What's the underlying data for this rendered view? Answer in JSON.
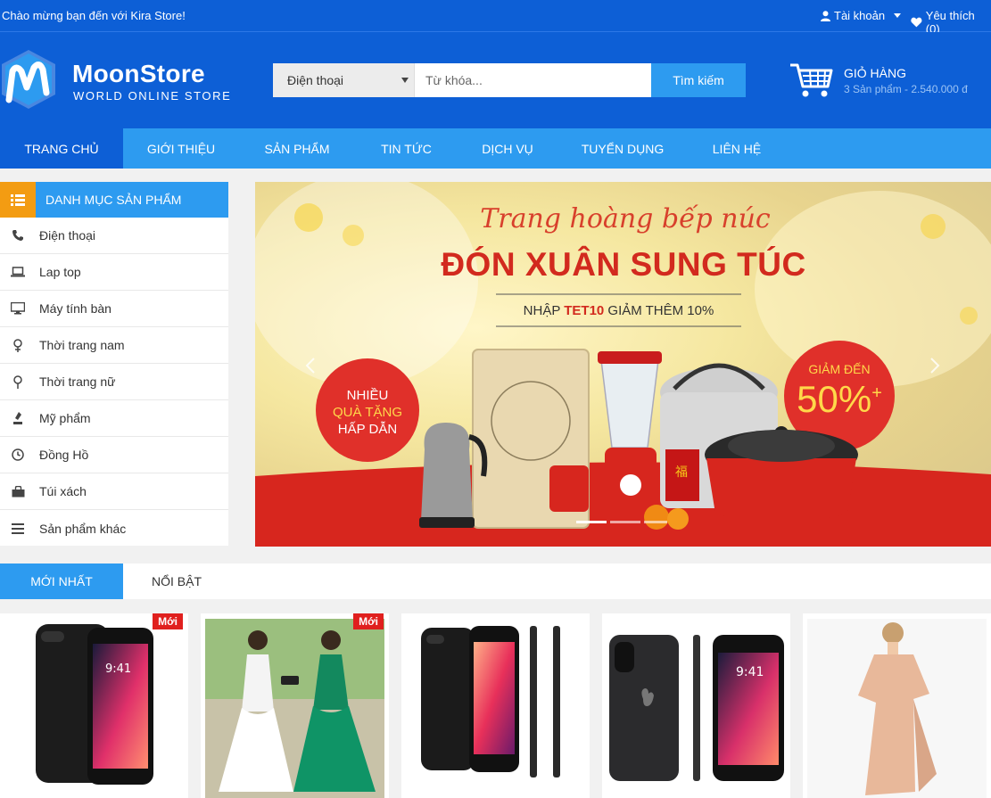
{
  "topbar": {
    "welcome": "Chào mừng bạn đến với Kira Store!",
    "account_label": "Tài khoản",
    "wishlist_label": "Yêu thích (0)"
  },
  "header": {
    "brand_name": "MoonStore",
    "tagline": "WORLD ONLINE STORE",
    "search": {
      "category_selected": "Điện thoại",
      "placeholder": "Từ khóa...",
      "button_label": "Tìm kiếm"
    },
    "cart": {
      "title": "GIỎ HÀNG",
      "summary": "3 Sản phẩm - 2.540.000 đ"
    }
  },
  "nav": {
    "items": [
      "TRANG CHỦ",
      "GIỚI THIỆU",
      "SẢN PHẨM",
      "TIN TỨC",
      "DỊCH VỤ",
      "TUYỂN DỤNG",
      "LIÊN HỆ"
    ],
    "active_index": 0
  },
  "sidebar": {
    "title": "DANH MỤC SẢN PHẨM",
    "items": [
      {
        "label": "Điện thoại",
        "icon": "phone-icon"
      },
      {
        "label": "Lap top",
        "icon": "laptop-icon"
      },
      {
        "label": "Máy tính bàn",
        "icon": "desktop-icon"
      },
      {
        "label": "Thời trang nam",
        "icon": "male-icon"
      },
      {
        "label": "Thời trang nữ",
        "icon": "female-icon"
      },
      {
        "label": "Mỹ phẩm",
        "icon": "cosmetic-icon"
      },
      {
        "label": "Đồng Hồ",
        "icon": "clock-icon"
      },
      {
        "label": "Túi xách",
        "icon": "bag-icon"
      },
      {
        "label": "Sản phẩm khác",
        "icon": "list-icon"
      }
    ]
  },
  "banner": {
    "script_title": "Trang hoàng bếp núc",
    "headline": "ĐÓN XUÂN SUNG TÚC",
    "promo_prefix": "NHẬP ",
    "promo_code": "TET10",
    "promo_suffix": " GIẢM THÊM 10%",
    "gift_line1": "NHIỀU",
    "gift_line2": "QUÀ TẶNG",
    "gift_line3": "HẤP DẪN",
    "discount_label": "GIẢM ĐẾN",
    "discount_value": "50%",
    "discount_plus": "+"
  },
  "tabs": {
    "newest": "MỚI NHẤT",
    "featured": "NỔI BẬT"
  },
  "products": [
    {
      "badge": "Mới",
      "type": "phone-case"
    },
    {
      "badge": "Mới",
      "type": "dress-photo"
    },
    {
      "badge": "",
      "type": "phone-black"
    },
    {
      "badge": "",
      "type": "phone-gray"
    },
    {
      "badge": "",
      "type": "dress-beige"
    }
  ],
  "colors": {
    "primary_dark": "#0d5fd6",
    "primary_light": "#2d9bf0",
    "accent_orange": "#f39c12",
    "badge_red": "#e0201e"
  }
}
